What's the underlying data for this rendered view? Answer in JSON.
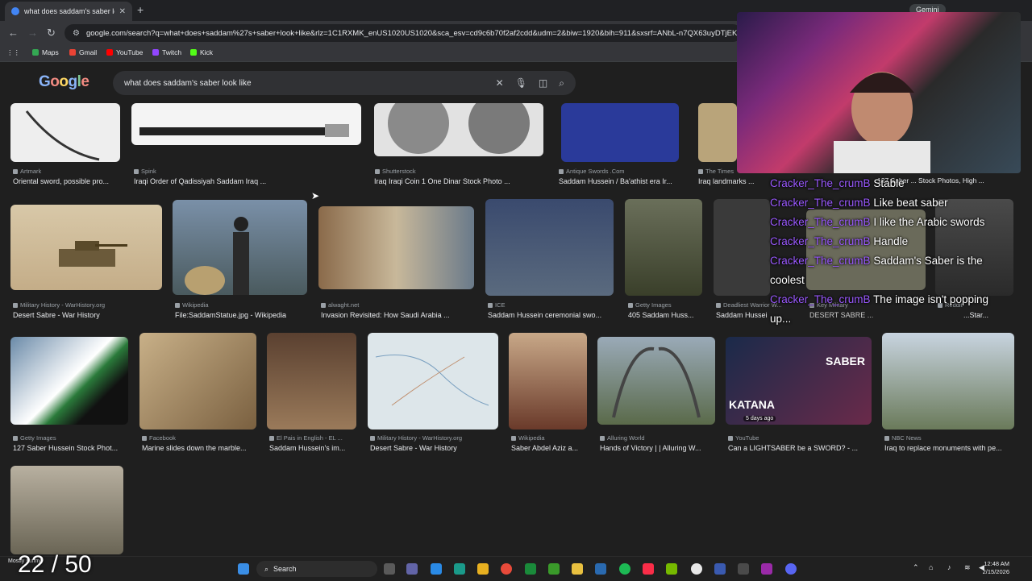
{
  "browser": {
    "tab_title": "what does saddam's saber look li",
    "tab_close": "✕",
    "new_tab": "+",
    "gemini_label": "Gemini",
    "url": "google.com/search?q=what+does+saddam%27s+saber+look+like&rlz=1C1RXMK_enUS1020US1020&sca_esv=cd9c6b70f2af2cdd&udm=2&biw=1920&bih=911&sxsrf=ANbL-n7QX63uyDTjEKc8I",
    "bookmarks": [
      {
        "label": "Maps",
        "color": "#34a853"
      },
      {
        "label": "Gmail",
        "color": "#ea4335"
      },
      {
        "label": "YouTube",
        "color": "#ff0000"
      },
      {
        "label": "Twitch",
        "color": "#9146ff"
      },
      {
        "label": "Kick",
        "color": "#53fc18"
      }
    ]
  },
  "search": {
    "logo": "Google",
    "query": "what does saddam's saber look like"
  },
  "results": [
    {
      "source": "Artmark",
      "title": "Oriental sword, possible pro...",
      "color": "#e8e8e8"
    },
    {
      "source": "Spink",
      "title": "Iraqi Order of Qadissiyah Saddam Iraq ...",
      "color": "#f0f0f0"
    },
    {
      "source": "Shutterstock",
      "title": "Iraq Iraqi Coin 1 One Dinar Stock Photo ...",
      "color": "#d9d9d9"
    },
    {
      "source": "Antique Swords .Com",
      "title": "Saddam Hussein / Ba'athist era Ir...",
      "color": "#2a3a9a"
    },
    {
      "source": "The Times",
      "title": "Iraq landmarks ...",
      "color": "#b9a47a"
    },
    {
      "source": "Military History - WarHistory.org",
      "title": "Desert Sabre - War History",
      "color": "#c9b89a"
    },
    {
      "source": "Wikipedia",
      "title": "File:SaddamStatue.jpg - Wikipedia",
      "color": "#6a7d8e"
    },
    {
      "source": "alwaght.net",
      "title": "Invasion Revisited: How Saudi Arabia ...",
      "color": "#8a6a4a"
    },
    {
      "source": "ICE",
      "title": "Saddam Hussein ceremonial swo...",
      "color": "#4a5a6e"
    },
    {
      "source": "Getty Images",
      "title": "405 Saddam Huss...",
      "color": "#5a5f4a"
    },
    {
      "source": "Deadliest Warrior W...",
      "title": "Saddam Hussein",
      "color": "#3a3a3a"
    },
    {
      "source": "Key Military",
      "title": "DESERT SABRE ...",
      "color": "#6a6a5a"
    },
    {
      "source": "Reddit",
      "title": "...Star...",
      "color": "#3c3c3c"
    },
    {
      "source": "Getty Images",
      "title": "127 Saber Hussein Stock Phot...",
      "color": "#5a7a5a"
    },
    {
      "source": "Facebook",
      "title": "Marine slides down the marble...",
      "color": "#9a8060"
    },
    {
      "source": "El Pais in English - EL ...",
      "title": "Saddam Hussein's im...",
      "color": "#7a6040"
    },
    {
      "source": "Military History - WarHistory.org",
      "title": "Desert Sabre - War History",
      "color": "#dde6ea"
    },
    {
      "source": "Wikipedia",
      "title": "Saber Abdel Aziz a...",
      "color": "#8a5040"
    },
    {
      "source": "Alluring World",
      "title": "Hands of Victory | | Alluring W...",
      "color": "#7a8a6a"
    },
    {
      "source": "YouTube",
      "title": "Can a LIGHTSABER be a SWORD? - ...",
      "color": "#3a4a6a"
    },
    {
      "source": "NBC News",
      "title": "Iraq to replace monuments with pe...",
      "color": "#8a9aa8"
    },
    {
      "source": "",
      "title": "",
      "color": "#6a6555"
    }
  ],
  "overlay_text": {
    "katana": "KATANA",
    "saber": "SABER",
    "days_ago": "5 days ago",
    "stock_snip": "127 Saber ... Stock Photos, High ..."
  },
  "chat": [
    {
      "user": "Cracker_The_crumB",
      "msg": "Stable"
    },
    {
      "user": "Cracker_The_crumB",
      "msg": "Like beat saber"
    },
    {
      "user": "Cracker_The_crumB",
      "msg": "I like the Arabic swords"
    },
    {
      "user": "Cracker_The_crumB",
      "msg": "Handle"
    },
    {
      "user": "Cracker_The_crumB",
      "msg": "Saddam's Saber is the coolest"
    },
    {
      "user": "Cracker_The_crumB",
      "msg": "The image isn't popping up..."
    }
  ],
  "stream": {
    "counter": "22 / 50",
    "counter_sub": "Mostly sunny"
  },
  "taskbar": {
    "search_label": "Search",
    "time": "12:48 AM",
    "date": "2/15/2026"
  }
}
